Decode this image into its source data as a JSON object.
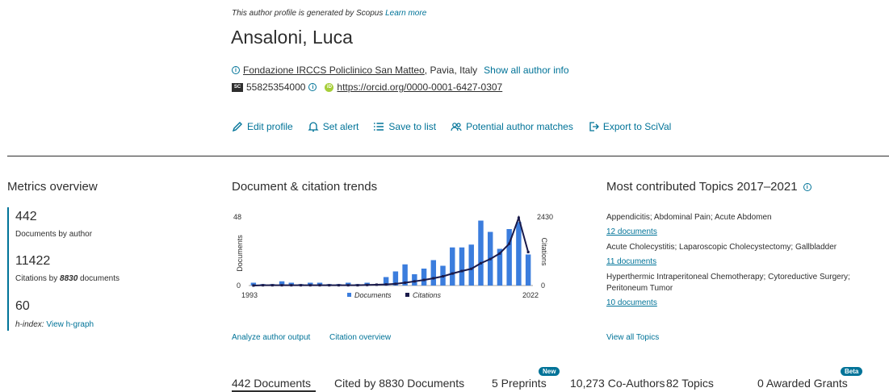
{
  "header": {
    "disclaimer": "This author profile is generated by Scopus",
    "learn_more": "Learn more",
    "author_name": "Ansaloni, Luca",
    "affiliation_link": "Fondazione IRCCS Policlinico San Matteo",
    "affiliation_rest": ", Pavia, Italy",
    "show_all": "Show all author info",
    "scopus_id": "55825354000",
    "orcid_url": "https://orcid.org/0000-0001-6427-0307"
  },
  "actions": [
    {
      "label": "Edit profile",
      "icon": "pencil-icon"
    },
    {
      "label": "Set alert",
      "icon": "bell-icon"
    },
    {
      "label": "Save to list",
      "icon": "list-icon"
    },
    {
      "label": "Potential author matches",
      "icon": "people-icon"
    },
    {
      "label": "Export to SciVal",
      "icon": "export-icon"
    }
  ],
  "metrics": {
    "title": "Metrics overview",
    "documents_value": "442",
    "documents_label": "Documents by author",
    "citations_value": "11422",
    "citations_label_pre": "Citations by ",
    "citations_label_num": "8830",
    "citations_label_post": " documents",
    "hindex_value": "60",
    "hindex_label": "h-index:",
    "hindex_link": "View h-graph"
  },
  "trends": {
    "title": "Document & citation trends",
    "analyze_link": "Analyze author output",
    "citation_link": "Citation overview"
  },
  "chart_data": {
    "type": "bar",
    "x": [
      1993,
      1994,
      1995,
      1996,
      1997,
      1998,
      1999,
      2000,
      2001,
      2002,
      2003,
      2004,
      2005,
      2006,
      2007,
      2008,
      2009,
      2010,
      2011,
      2012,
      2013,
      2014,
      2015,
      2016,
      2017,
      2018,
      2019,
      2020,
      2021,
      2022
    ],
    "series": [
      {
        "name": "Documents",
        "type": "bar",
        "axis": "left",
        "color": "#3b7ddd",
        "values": [
          2,
          1,
          1,
          3,
          2,
          1,
          2,
          2,
          1,
          1,
          2,
          1,
          2,
          1,
          6,
          10,
          15,
          8,
          12,
          18,
          14,
          27,
          27,
          29,
          46,
          38,
          26,
          40,
          45,
          22
        ]
      },
      {
        "name": "Citations",
        "type": "line",
        "axis": "right",
        "color": "#1a1a4a",
        "values": [
          0,
          10,
          10,
          10,
          10,
          10,
          10,
          10,
          10,
          10,
          10,
          10,
          20,
          30,
          40,
          60,
          100,
          150,
          200,
          260,
          330,
          430,
          520,
          600,
          800,
          950,
          1150,
          1500,
          2430,
          1200
        ]
      }
    ],
    "ylabel_left": "Documents",
    "ylabel_right": "Citations",
    "ylim_left": [
      0,
      48
    ],
    "ylim_right": [
      0,
      2430
    ],
    "ytick_left": [
      "48",
      "0"
    ],
    "ytick_right": [
      "2430",
      "0"
    ],
    "xtick_labels": [
      "1993",
      "2022"
    ],
    "legend_placement": "bottom"
  },
  "topics": {
    "title": "Most contributed Topics 2017–2021",
    "items": [
      {
        "name": "Appendicitis; Abdominal Pain; Acute Abdomen",
        "docs": "12 documents"
      },
      {
        "name": "Acute Cholecystitis; Laparoscopic Cholecystectomy; Gallbladder",
        "docs": "11 documents"
      },
      {
        "name": "Hyperthermic Intraperitoneal Chemotherapy; Cytoreductive Surgery; Peritoneum Tumor",
        "docs": "10 documents"
      }
    ],
    "view_all": "View all Topics"
  },
  "tabs": [
    {
      "label": "442 Documents"
    },
    {
      "label": "Cited by 8830 Documents"
    },
    {
      "label": "5 Preprints",
      "badge": "New"
    },
    {
      "label": "10,273 Co-Authors"
    },
    {
      "label": "82 Topics"
    },
    {
      "label": "0 Awarded Grants",
      "badge": "Beta"
    }
  ],
  "colors": {
    "accent": "#007398",
    "bar": "#3b7ddd",
    "line": "#1a1a4a"
  }
}
